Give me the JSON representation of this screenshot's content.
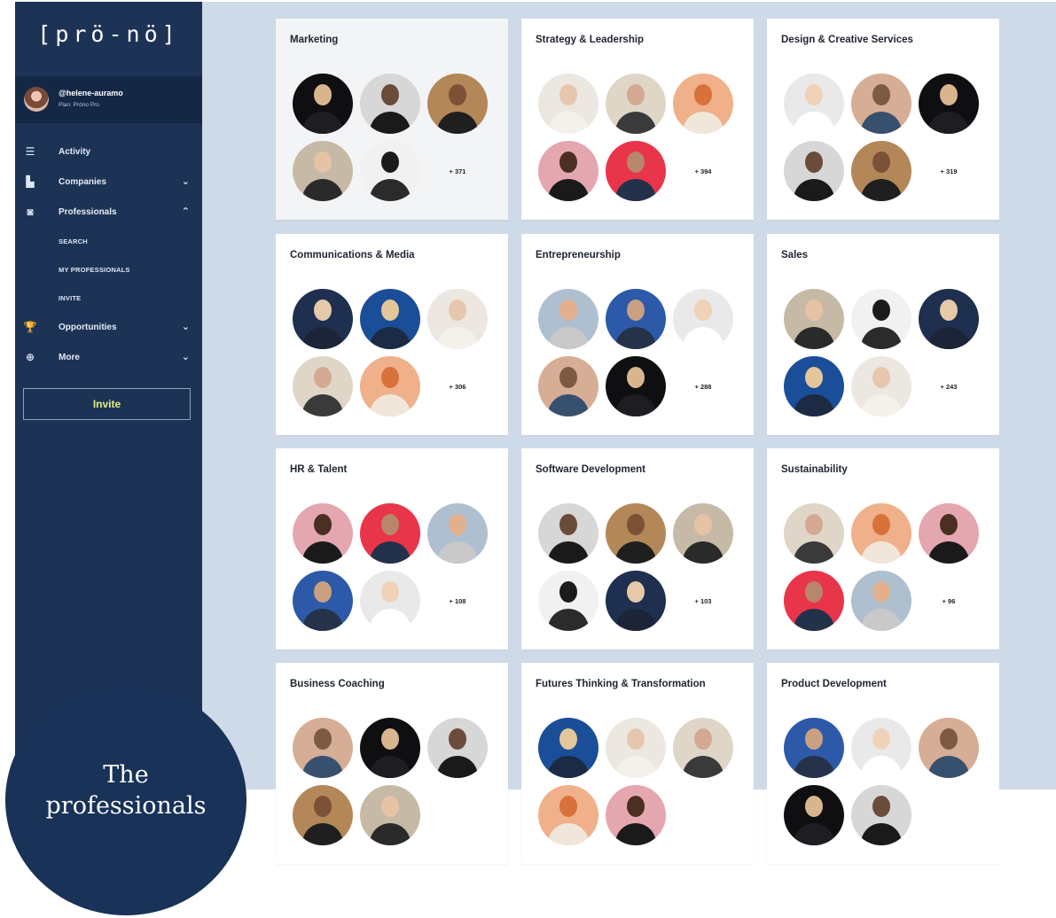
{
  "app": {
    "logo": "[prö-nö]"
  },
  "user": {
    "handle": "@helene-auramo",
    "plan": "Plan: Pröno Pro"
  },
  "nav": {
    "items": [
      {
        "label": "Activity",
        "icon": "activity-list-icon",
        "glyph": "☰"
      },
      {
        "label": "Companies",
        "icon": "companies-building-icon",
        "glyph": "▙",
        "chevron": "⌄"
      },
      {
        "label": "Professionals",
        "icon": "professionals-badge-icon",
        "glyph": "◙",
        "chevron": "⌃"
      },
      {
        "label": "Opportunities",
        "icon": "trophy-icon",
        "glyph": "🏆",
        "chevron": "⌄"
      },
      {
        "label": "More",
        "icon": "plus-circle-icon",
        "glyph": "⊕",
        "chevron": "⌄"
      }
    ],
    "professionals_sub": [
      "SEARCH",
      "MY PROFESSIONALS",
      "INVITE"
    ]
  },
  "invite_button": "Invite",
  "badge_text": "The\nprofessionals",
  "categories": [
    {
      "title": "Marketing",
      "count": "+ 371"
    },
    {
      "title": "Strategy & Leadership",
      "count": "+ 394"
    },
    {
      "title": "Design & Creative Services",
      "count": "+ 319"
    },
    {
      "title": "Communications & Media",
      "count": "+ 306"
    },
    {
      "title": "Entrepreneurship",
      "count": "+ 288"
    },
    {
      "title": "Sales",
      "count": "+ 243"
    },
    {
      "title": "HR & Talent",
      "count": "+ 108"
    },
    {
      "title": "Software Development",
      "count": "+ 103"
    },
    {
      "title": "Sustainability",
      "count": "+ 96"
    },
    {
      "title": "Business Coaching",
      "count": ""
    },
    {
      "title": "Futures Thinking & Transformation",
      "count": ""
    },
    {
      "title": "Product Development",
      "count": ""
    }
  ],
  "colors": {
    "sidebar": "#1c3356",
    "user_bar": "#142846",
    "content_bg": "#cfdae8",
    "invite_text": "#e9ee7c",
    "badge": "#183258"
  },
  "avatar_palettes": [
    [
      "#0f0f12",
      "#d9b58e",
      "#1d1d22"
    ],
    [
      "#e8354a",
      "#b8866a",
      "#23324a"
    ],
    [
      "#1b4e98",
      "#e3c79a",
      "#1c2a44"
    ],
    [
      "#d7d7d7",
      "#6b4b3a",
      "#1a1a1a"
    ],
    [
      "#aebfd0",
      "#e2b08c",
      "#c9c9c9"
    ],
    [
      "#ece7e0",
      "#e6c7ad",
      "#f4f0ea"
    ],
    [
      "#b48758",
      "#7b5236",
      "#1f1f1f"
    ],
    [
      "#2d5aa8",
      "#caa083",
      "#25324a"
    ],
    [
      "#dfd6c8",
      "#d4a892",
      "#3a3a3a"
    ],
    [
      "#c6b9a6",
      "#e7c3a6",
      "#2a2a2a"
    ],
    [
      "#e9e9e9",
      "#f0d2b8",
      "#ffffff"
    ],
    [
      "#efb08a",
      "#d8723a",
      "#f0e6da"
    ],
    [
      "#f1f1f1",
      "#1b1b1b",
      "#2b2b2b"
    ],
    [
      "#d6ad95",
      "#7d5a44",
      "#37506e"
    ],
    [
      "#e4a7b0",
      "#4b2f22",
      "#1a1a1a"
    ],
    [
      "#1e2f4f",
      "#e6c9a8",
      "#1b2537"
    ]
  ]
}
